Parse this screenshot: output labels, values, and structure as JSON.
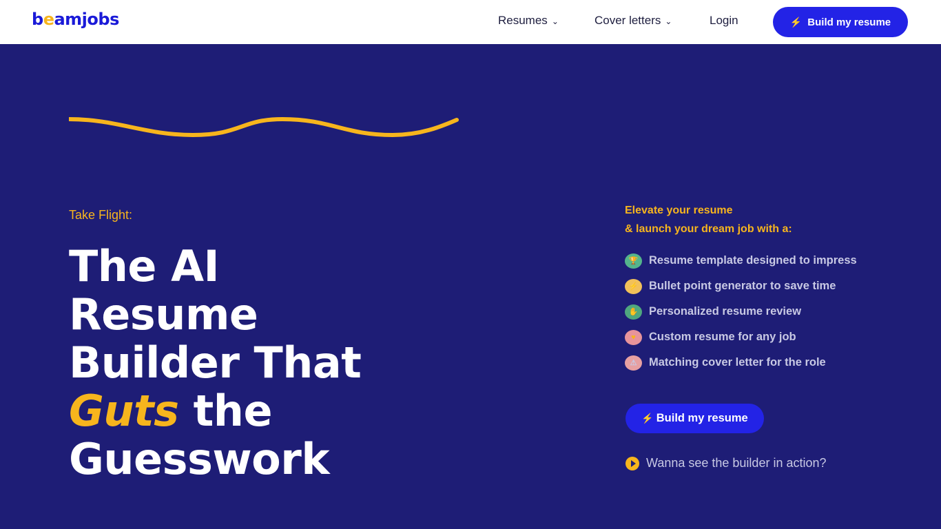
{
  "header": {
    "logo": {
      "b": "b",
      "e": "e",
      "rest": "amjobs"
    },
    "nav": [
      {
        "label": "Resumes"
      },
      {
        "label": "Cover letters"
      },
      {
        "label": "Login"
      }
    ],
    "cta_label": "Build my resume",
    "cta_icon": "lightning-bolt-icon"
  },
  "hero": {
    "eyebrow": "Take Flight:",
    "title": {
      "line1": "The AI",
      "line2": "Resume",
      "line3": "Builder That",
      "accent": "Guts",
      "line4_rest": " the",
      "line5": "Guesswork"
    }
  },
  "side": {
    "heading_line1": "Elevate your resume",
    "heading_line2": "& launch your dream job with a:",
    "features": [
      {
        "label": "Resume template designed to impress",
        "icon": "trophy-icon",
        "glyph": "🏆",
        "color": "#54b48c"
      },
      {
        "label": "Bullet point generator to save time",
        "icon": "lightning-icon",
        "glyph": "⚡",
        "color": "#f2c15a"
      },
      {
        "label": "Personalized resume review",
        "icon": "hand-icon",
        "glyph": "✋",
        "color": "#4fa77f"
      },
      {
        "label": "Custom resume for any job",
        "icon": "heart-icon",
        "glyph": "♥",
        "color": "#e8949b"
      },
      {
        "label": "Matching cover letter for the role",
        "icon": "warning-icon",
        "glyph": "⚠",
        "color": "#e7a0a2"
      }
    ],
    "cta_label": "Build my resume",
    "watch_label": "Wanna see the builder in action?"
  },
  "colors": {
    "brand": "#2323e6",
    "accent": "#f7b51d",
    "background": "#1e1d76"
  }
}
